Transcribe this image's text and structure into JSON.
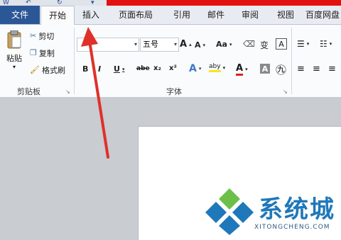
{
  "tabs": {
    "file": "文件",
    "home": "开始",
    "insert": "插入",
    "page_layout": "页面布局",
    "references": "引用",
    "mailings": "邮件",
    "review": "审阅",
    "view": "视图",
    "baidu": "百度网盘"
  },
  "clipboard": {
    "paste": "粘贴",
    "cut": "剪切",
    "copy": "复制",
    "format_painter": "格式刷",
    "group_label": "剪贴板"
  },
  "font": {
    "name_value": "",
    "size_value": "五号",
    "group_label": "字体",
    "grow": "A",
    "shrink": "A",
    "change_case": "Aa",
    "bold": "B",
    "italic": "I",
    "underline": "U",
    "strikethrough": "abe",
    "subscript": "x₂",
    "superscript": "x²",
    "text_effect": "A",
    "highlight": "aby",
    "font_color": "A",
    "char_shading": "A",
    "enclose": "㊈",
    "pinyin": "变",
    "border": "A"
  },
  "watermark": {
    "brand": "系统城",
    "site": "XITONGCHENG.COM"
  },
  "colors": {
    "accent_red": "#e31010",
    "file_tab": "#2b5797",
    "logo_blue": "#1f78b9",
    "logo_green": "#6cc04a"
  }
}
